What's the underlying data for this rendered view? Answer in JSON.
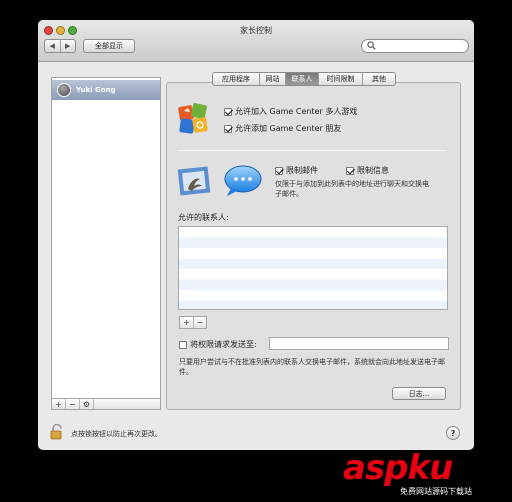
{
  "window": {
    "title": "家长控制"
  },
  "toolbar": {
    "back": "◀",
    "forward": "▶",
    "show_all": "全部显示",
    "search_placeholder": ""
  },
  "sidebar": {
    "users": [
      {
        "name": "Yuki Gong"
      }
    ],
    "controls": {
      "add": "+",
      "remove": "−",
      "gear": "⚙"
    }
  },
  "tabs": [
    {
      "label": "应用程序",
      "active": false
    },
    {
      "label": "网站",
      "active": false
    },
    {
      "label": "联系人",
      "active": true
    },
    {
      "label": "时间限制",
      "active": false
    },
    {
      "label": "其他",
      "active": false
    }
  ],
  "game_center": {
    "allow_multiplayer": {
      "label": "允许加入 Game Center 多人游戏",
      "checked": true
    },
    "allow_friends": {
      "label": "允许添加 Game Center 朋友",
      "checked": true
    }
  },
  "mail": {
    "limit_mail": {
      "label": "限制邮件",
      "checked": true
    },
    "limit_messages": {
      "label": "限制信息",
      "checked": true
    },
    "description": "仅限于与添加到此列表中的地址进行聊天和交换电子邮件。"
  },
  "contacts": {
    "label": "允许的联系人:",
    "items": [],
    "add": "+",
    "remove": "−"
  },
  "permission_request": {
    "label": "将权限请求发送至:",
    "checked": false,
    "value": ""
  },
  "note": "只要用户尝试与不在批准列表内的联系人交换电子邮件，系统就会向此地址发送电子邮件。",
  "log_button": "日志...",
  "footer": {
    "lock_text": "点按锁按钮以防止再次更改。",
    "help": "?"
  },
  "watermark": {
    "main": "aspku",
    "sub": "免费网站源码下载站"
  },
  "colors": {
    "selection": "#8e9cb7",
    "active_tab": "#8a8a8a",
    "list_stripe": "#edf2fb",
    "watermark": "#e60012"
  }
}
